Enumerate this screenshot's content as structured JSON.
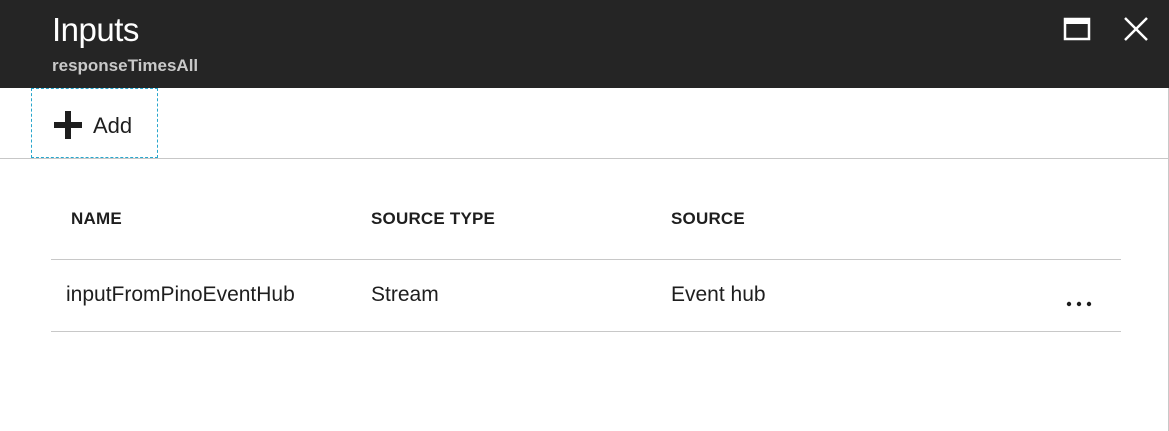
{
  "blade": {
    "title": "Inputs",
    "subtitle": "responseTimesAll",
    "maximize_icon": "maximize-icon",
    "close_icon": "close-icon"
  },
  "toolbar": {
    "add_label": "Add",
    "add_icon": "plus-icon"
  },
  "table": {
    "columns": [
      "NAME",
      "SOURCE TYPE",
      "SOURCE"
    ],
    "rows": [
      {
        "name": "inputFromPinoEventHub",
        "source_type": "Stream",
        "source": "Event hub",
        "more_icon": "ellipsis-icon"
      }
    ]
  },
  "colors": {
    "header_bg": "#252525",
    "focus_border": "#27a6cc",
    "divider": "#c8c8c8"
  }
}
